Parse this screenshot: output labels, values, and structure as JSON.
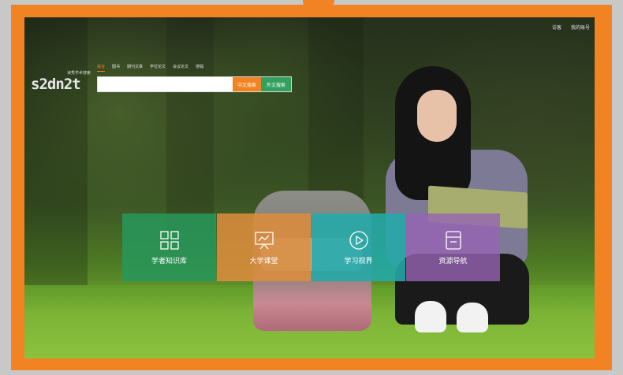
{
  "header": {
    "links": [
      "访客",
      "我的账号"
    ]
  },
  "logo": {
    "text": "s2dn2t",
    "sub": "读秀学术搜索"
  },
  "search": {
    "tabs": [
      "综合",
      "图书",
      "期刊文章",
      "学位论文",
      "会议论文",
      "搜狐"
    ],
    "active_tab": "综合",
    "input_value": "",
    "placeholder": "",
    "btn_chinese": "中文搜索",
    "btn_foreign": "外文搜索"
  },
  "tiles": [
    {
      "label": "学者知识库",
      "icon": "grid-icon",
      "color": "#28965a"
    },
    {
      "label": "大学课堂",
      "icon": "presentation-board-icon",
      "color": "#dc8c3c"
    },
    {
      "label": "学习视界",
      "icon": "play-circle-icon",
      "color": "#23aaaa"
    },
    {
      "label": "资源导航",
      "icon": "document-icon",
      "color": "#9664b4"
    }
  ],
  "colors": {
    "frame": "#f28322",
    "accent": "#f28322",
    "secondary": "#33a060"
  }
}
